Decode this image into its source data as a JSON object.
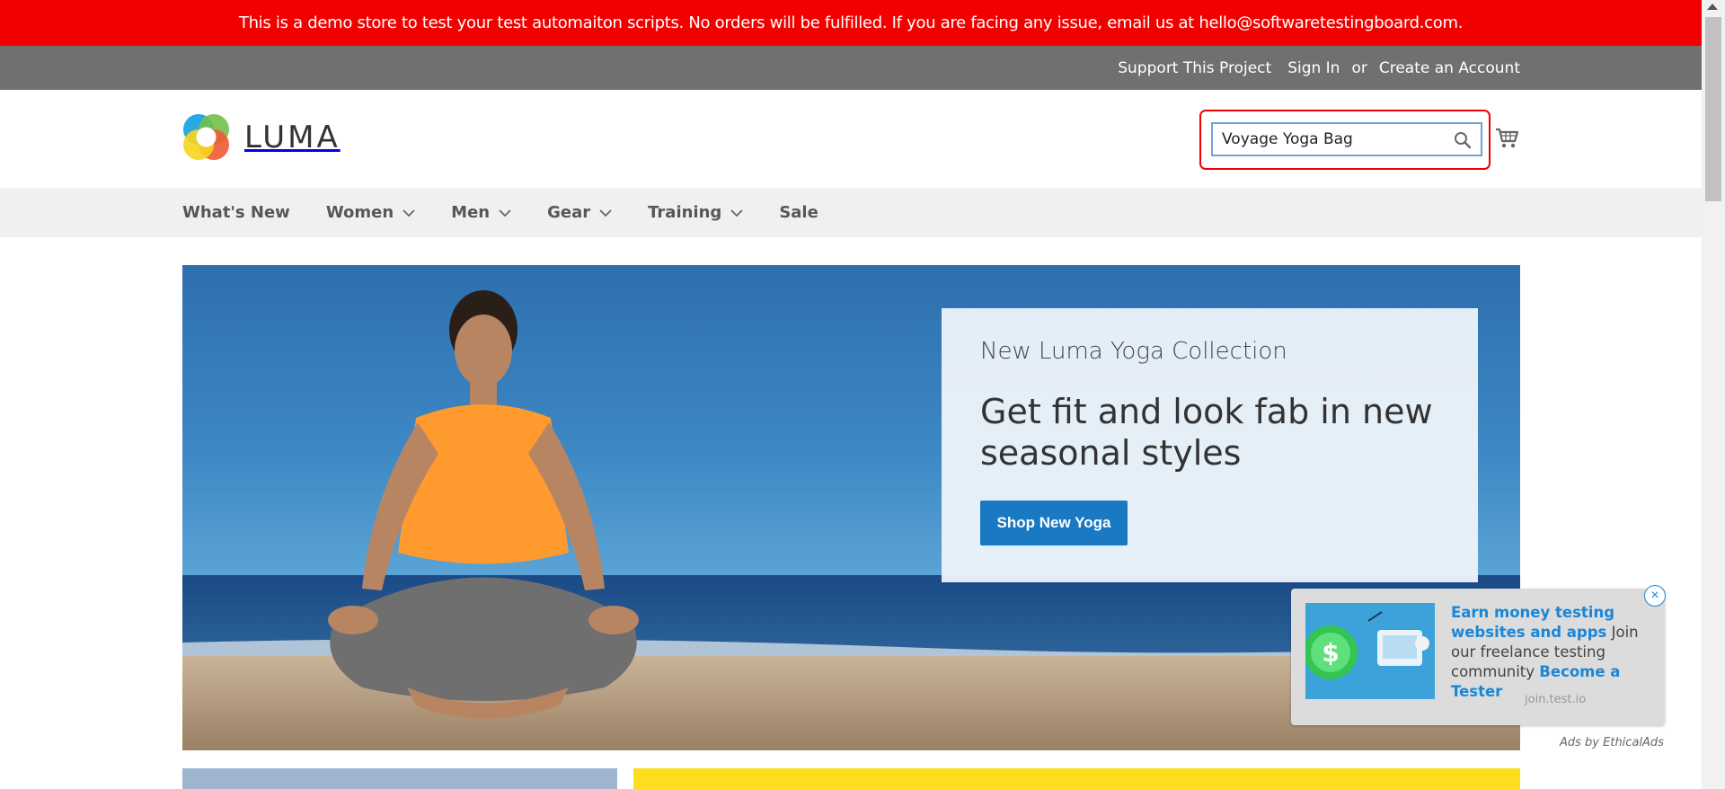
{
  "notice": {
    "text": "This is a demo store to test your test automaiton scripts. No orders will be fulfilled. If you are facing any issue, email us at hello@softwaretestingboard.com."
  },
  "toplinks": {
    "support": "Support This Project",
    "sign_in": "Sign In",
    "or": "or",
    "create_account": "Create an Account"
  },
  "header": {
    "logo_text": "LUMA",
    "search": {
      "value": "Voyage Yoga Bag"
    },
    "icons": {
      "search": "search-icon",
      "cart": "cart-icon"
    }
  },
  "nav": {
    "items": [
      {
        "label": "What's New"
      },
      {
        "label": "Women"
      },
      {
        "label": "Men"
      },
      {
        "label": "Gear"
      },
      {
        "label": "Training"
      },
      {
        "label": "Sale"
      }
    ]
  },
  "hero": {
    "eyebrow": "New Luma Yoga Collection",
    "headline": "Get fit and look fab in new seasonal styles",
    "cta": "Shop New Yoga"
  },
  "ad": {
    "headline": "Earn money testing websites and apps",
    "body": " Join our freelance testing community ",
    "cta": "Become a Tester",
    "domain": "join.test.io",
    "close": "×",
    "by": "Ads by EthicalAds"
  },
  "colors": {
    "notice_bg": "#f20000",
    "toplinks_bg": "#6e716e",
    "nav_bg": "#f0f0f0",
    "cta_bg": "#1979c3",
    "ad_link": "#1a86d6"
  }
}
